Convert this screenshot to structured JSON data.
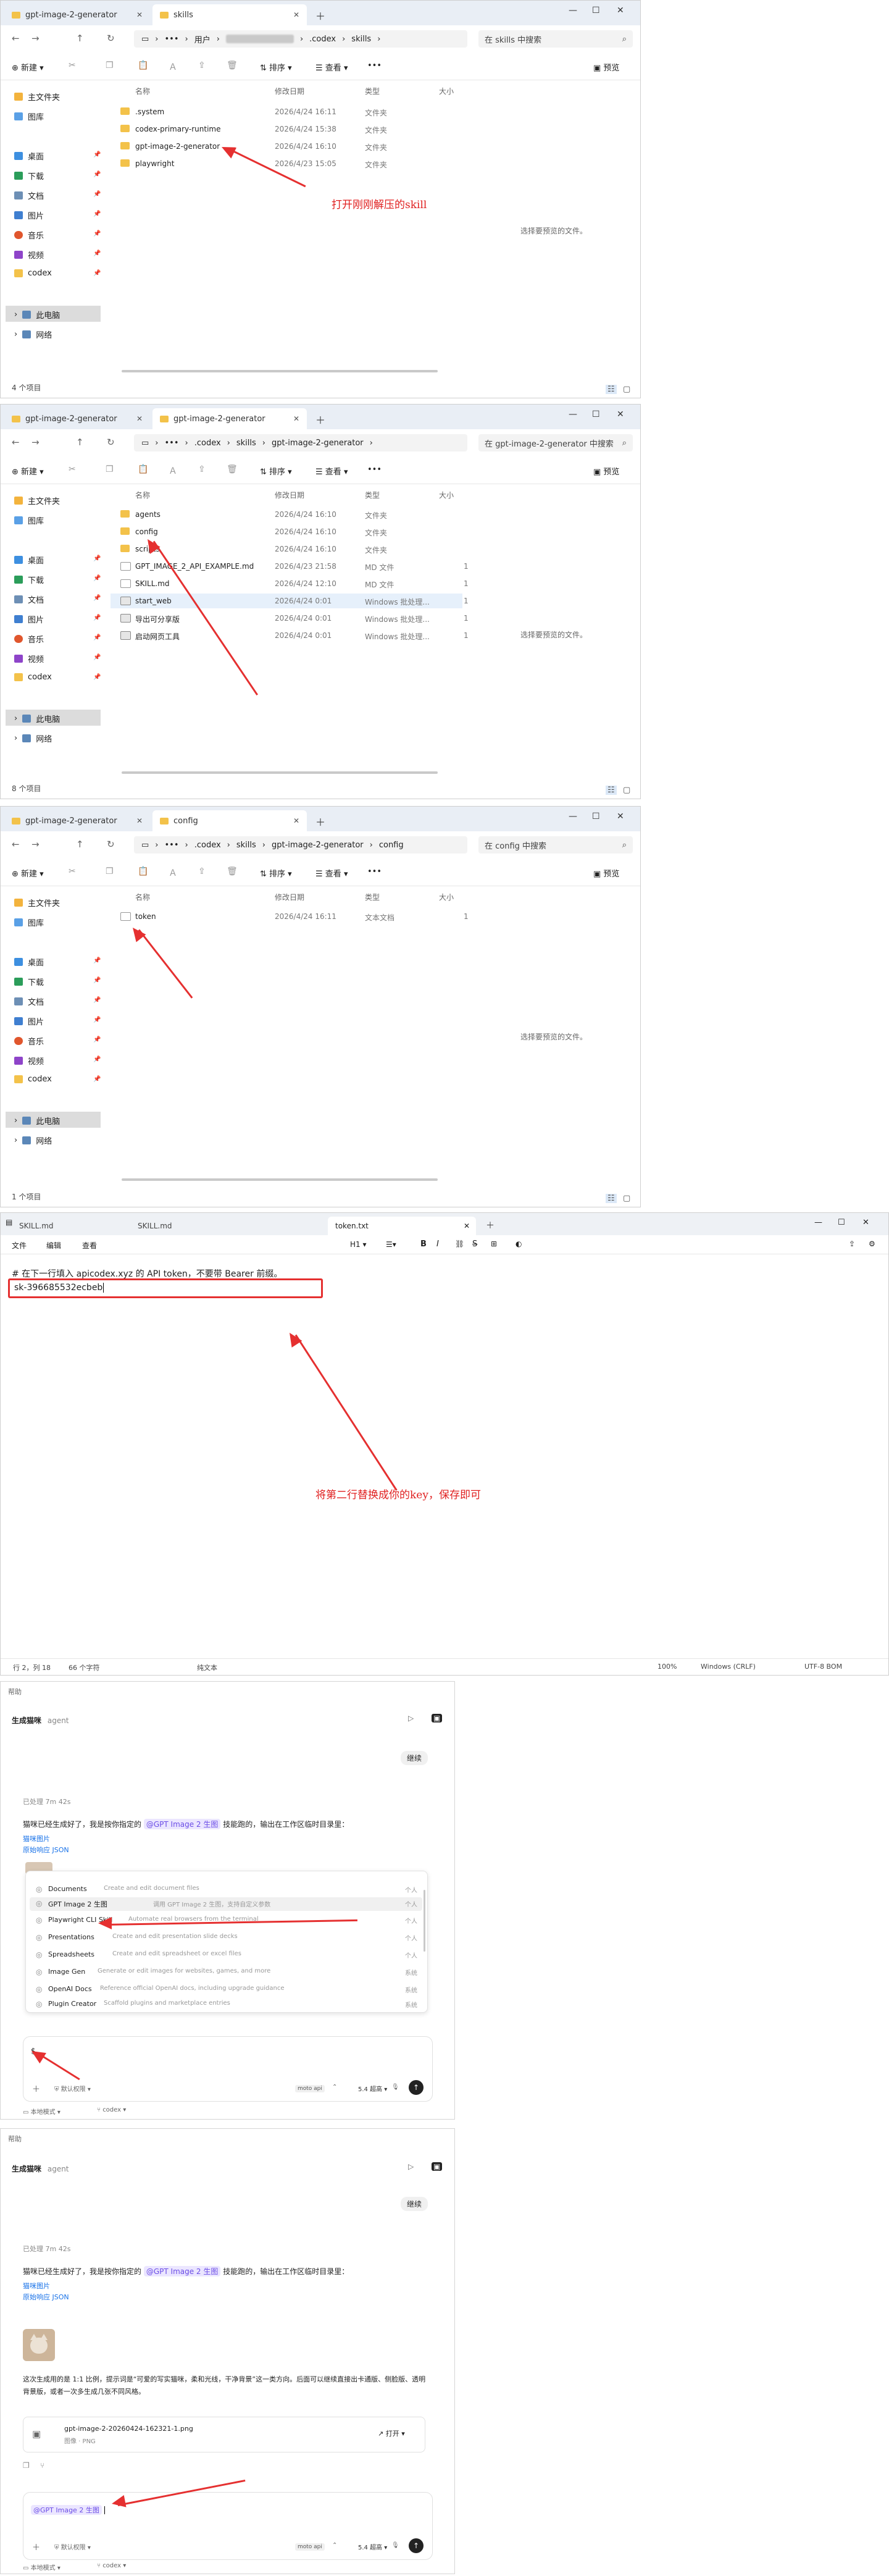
{
  "explorer1": {
    "tabs": [
      "gpt-image-2-generator",
      "skills"
    ],
    "path": [
      "用户",
      ".codex",
      "skills"
    ],
    "search_placeholder": "在 skills 中搜索",
    "toolbar": {
      "new": "新建",
      "sort": "排序",
      "view": "查看",
      "more": "•••",
      "preview": "预览"
    },
    "columns": [
      "名称",
      "修改日期",
      "类型",
      "大小"
    ],
    "rows": [
      {
        "name": ".system",
        "date": "2026/4/24 16:11",
        "type": "文件夹"
      },
      {
        "name": "codex-primary-runtime",
        "date": "2026/4/24 15:38",
        "type": "文件夹"
      },
      {
        "name": "gpt-image-2-generator",
        "date": "2026/4/24 16:10",
        "type": "文件夹"
      },
      {
        "name": "playwright",
        "date": "2026/4/23 15:05",
        "type": "文件夹"
      }
    ],
    "preview_text": "选择要预览的文件。",
    "status": "4 个项目",
    "annotation": "打开刚刚解压的skill"
  },
  "sidebar": {
    "items": [
      "主文件夹",
      "图库",
      "桌面",
      "下载",
      "文档",
      "图片",
      "音乐",
      "视频",
      "codex"
    ],
    "this_pc": "此电脑",
    "network": "网络"
  },
  "explorer2": {
    "tabs": [
      "gpt-image-2-generator",
      "gpt-image-2-generator"
    ],
    "path": [
      ".codex",
      "skills",
      "gpt-image-2-generator"
    ],
    "search_placeholder": "在 gpt-image-2-generator 中搜索",
    "rows": [
      {
        "name": "agents",
        "date": "2026/4/24 16:10",
        "type": "文件夹",
        "size": ""
      },
      {
        "name": "config",
        "date": "2026/4/24 16:10",
        "type": "文件夹",
        "size": ""
      },
      {
        "name": "scripts",
        "date": "2026/4/24 16:10",
        "type": "文件夹",
        "size": ""
      },
      {
        "name": "GPT_IMAGE_2_API_EXAMPLE.md",
        "date": "2026/4/23 21:58",
        "type": "MD 文件",
        "size": "1"
      },
      {
        "name": "SKILL.md",
        "date": "2026/4/24 12:10",
        "type": "MD 文件",
        "size": "1"
      },
      {
        "name": "start_web",
        "date": "2026/4/24 0:01",
        "type": "Windows 批处理...",
        "size": "1"
      },
      {
        "name": "导出可分享版",
        "date": "2026/4/24 0:01",
        "type": "Windows 批处理...",
        "size": "1"
      },
      {
        "name": "启动网页工具",
        "date": "2026/4/24 0:01",
        "type": "Windows 批处理...",
        "size": "1"
      }
    ],
    "status": "8 个项目"
  },
  "explorer3": {
    "tabs": [
      "gpt-image-2-generator",
      "config"
    ],
    "path": [
      ".codex",
      "skills",
      "gpt-image-2-generator",
      "config"
    ],
    "search_placeholder": "在 config 中搜索",
    "rows": [
      {
        "name": "token",
        "date": "2026/4/24 16:11",
        "type": "文本文档",
        "size": "1"
      }
    ],
    "status": "1 个项目"
  },
  "editor": {
    "tabs": [
      "SKILL.md",
      "SKILL.md",
      "token.txt"
    ],
    "menu": [
      "文件",
      "编辑",
      "查看"
    ],
    "heading_level": "H1",
    "line1": "# 在下一行填入 apicodex.xyz 的 API token，不要带 Bearer 前缀。",
    "line2": "sk-396685532ecbeb",
    "annotation": "将第二行替换成你的key，保存即可",
    "status_pos": "行 2，列 18",
    "status_chars": "66 个字符",
    "status_mode": "纯文本",
    "status_zoom": "100%",
    "status_eol": "Windows (CRLF)",
    "status_enc": "UTF-8 BOM"
  },
  "chat1": {
    "help": "帮助",
    "title": "生成猫咪",
    "badge": "agent",
    "continue_btn": "继续",
    "processed": "已处理 7m 42s",
    "msg_a": "猫咪已经生成好了，我是按你指定的",
    "msg_chip": "@GPT Image 2 生图",
    "msg_b": "技能跑的，输出在工作区临时目录里：",
    "link1": "猫咪图片",
    "link2": "原始响应 JSON",
    "skills": [
      {
        "name": "Documents",
        "desc": "Create and edit document files",
        "scope": "个人"
      },
      {
        "name": "GPT Image 2 生图",
        "desc": "调用 GPT Image 2 生图，支持自定义参数",
        "scope": "个人"
      },
      {
        "name": "Playwright CLI Skill",
        "desc": "Automate real browsers from the terminal",
        "scope": "个人"
      },
      {
        "name": "Presentations",
        "desc": "Create and edit presentation slide decks",
        "scope": "个人"
      },
      {
        "name": "Spreadsheets",
        "desc": "Create and edit spreadsheet or excel files",
        "scope": "个人"
      },
      {
        "name": "Image Gen",
        "desc": "Generate or edit images for websites, games, and more",
        "scope": "系统"
      },
      {
        "name": "OpenAI Docs",
        "desc": "Reference official OpenAI docs, including upgrade guidance",
        "scope": "系统"
      },
      {
        "name": "Plugin Creator",
        "desc": "Scaffold plugins and marketplace entries",
        "scope": "系统"
      }
    ],
    "input_value": "$",
    "perm": "默认权限",
    "mode_chip": "moto api",
    "model": "5.4 超高",
    "local_mode": "本地模式",
    "branch": "codex"
  },
  "chat2": {
    "help": "帮助",
    "title": "生成猫咪",
    "badge": "agent",
    "continue_btn": "继续",
    "processed": "已处理 7m 42s",
    "msg_a": "猫咪已经生成好了，我是按你指定的",
    "msg_chip": "@GPT Image 2 生图",
    "msg_b": "技能跑的，输出在工作区临时目录里：",
    "link1": "猫咪图片",
    "link2": "原始响应 JSON",
    "desc": "这次生成用的是 1:1 比例，提示词是“可爱的写实猫咪，柔和光线，干净背景”这一类方向。后面可以继续直接出卡通版、侧脸版、透明背景版，或者一次多生成几张不同风格。",
    "file_name": "gpt-image-2-20260424-162321-1.png",
    "file_type": "图像 · PNG",
    "open_btn": "打开",
    "input_chip": "@GPT Image 2 生图",
    "perm": "默认权限",
    "mode_chip": "moto api",
    "model": "5.4 超高",
    "local_mode": "本地模式",
    "branch": "codex"
  }
}
